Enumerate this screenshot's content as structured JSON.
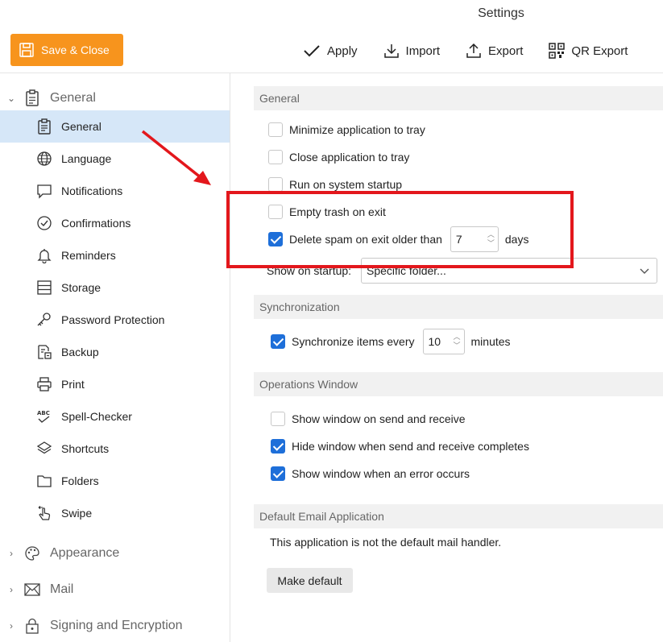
{
  "window": {
    "title": "Settings"
  },
  "toolbar": {
    "save_close": "Save & Close",
    "apply": "Apply",
    "import": "Import",
    "export": "Export",
    "qr_export": "QR Export"
  },
  "sidebar": {
    "categories": [
      {
        "label": "General",
        "icon": "clipboard-icon",
        "expanded": true
      },
      {
        "label": "Appearance",
        "icon": "palette-icon",
        "expanded": false
      },
      {
        "label": "Mail",
        "icon": "envelope-icon",
        "expanded": false
      },
      {
        "label": "Signing and Encryption",
        "icon": "lock-icon",
        "expanded": false
      }
    ],
    "items": [
      {
        "label": "General",
        "icon": "clipboard-icon",
        "selected": true
      },
      {
        "label": "Language",
        "icon": "globe-icon"
      },
      {
        "label": "Notifications",
        "icon": "speech-bubble-icon"
      },
      {
        "label": "Confirmations",
        "icon": "check-circle-icon"
      },
      {
        "label": "Reminders",
        "icon": "bell-icon"
      },
      {
        "label": "Storage",
        "icon": "storage-icon"
      },
      {
        "label": "Password Protection",
        "icon": "key-icon"
      },
      {
        "label": "Backup",
        "icon": "backup-icon"
      },
      {
        "label": "Print",
        "icon": "printer-icon"
      },
      {
        "label": "Spell-Checker",
        "icon": "spellcheck-icon"
      },
      {
        "label": "Shortcuts",
        "icon": "layers-icon"
      },
      {
        "label": "Folders",
        "icon": "folder-icon"
      },
      {
        "label": "Swipe",
        "icon": "hand-swipe-icon"
      }
    ]
  },
  "general": {
    "header": "General",
    "minimize_tray": {
      "label": "Minimize application to tray",
      "checked": false
    },
    "close_tray": {
      "label": "Close application to tray",
      "checked": false
    },
    "run_startup": {
      "label": "Run on system startup",
      "checked": false
    },
    "empty_trash": {
      "label": "Empty trash on exit",
      "checked": false
    },
    "delete_spam": {
      "label": "Delete spam on exit older than",
      "checked": true,
      "value": "7",
      "unit": "days"
    },
    "show_on_startup": {
      "label": "Show on startup:",
      "value": "Specific folder..."
    }
  },
  "sync": {
    "header": "Synchronization",
    "sync_items": {
      "label": "Synchronize items every",
      "checked": true,
      "value": "10",
      "unit": "minutes"
    }
  },
  "operations": {
    "header": "Operations Window",
    "show_send_receive": {
      "label": "Show window on send and receive",
      "checked": false
    },
    "hide_complete": {
      "label": "Hide window when send and receive completes",
      "checked": true
    },
    "show_error": {
      "label": "Show window when an error occurs",
      "checked": true
    }
  },
  "default_email": {
    "header": "Default Email Application",
    "note": "This application is not the default mail handler.",
    "button": "Make default"
  },
  "colors": {
    "accent": "#f7941d",
    "checkbox": "#1e6fd9",
    "selection": "#d6e7f8",
    "annotation": "#e3171c"
  }
}
